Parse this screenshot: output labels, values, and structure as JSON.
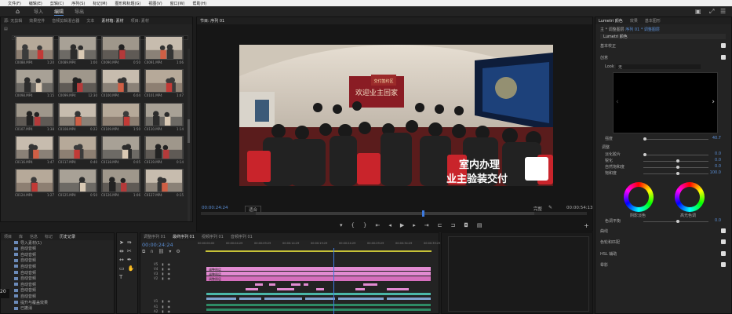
{
  "menu": [
    "文件(F)",
    "编辑(E)",
    "剪辑(C)",
    "序列(S)",
    "标记(M)",
    "图形和标题(G)",
    "视图(V)",
    "窗口(W)",
    "帮助(H)"
  ],
  "workspace_tabs": [
    "导入",
    "编辑",
    "导出"
  ],
  "source_tabs": [
    "源: 无剪辑",
    "效果控件",
    "音频剪辑混合器",
    "文本",
    "素材箱: 素材",
    "项目: 素材"
  ],
  "program_tab": "节目: 序列 01",
  "clips": [
    {
      "name": "C0088.MP4",
      "dur": "1:20"
    },
    {
      "name": "C0089.MP4",
      "dur": "1:00"
    },
    {
      "name": "C0090.MP4",
      "dur": "0:50"
    },
    {
      "name": "C0091.MP4",
      "dur": "1:06"
    },
    {
      "name": "C0098.MP4",
      "dur": "1:15"
    },
    {
      "name": "C0099.MP4",
      "dur": "12:30"
    },
    {
      "name": "C0100.MP4",
      "dur": "6:04"
    },
    {
      "name": "C0101.MP4",
      "dur": "1:47"
    },
    {
      "name": "C0107.MP4",
      "dur": "1:38"
    },
    {
      "name": "C0108.MP4",
      "dur": "0:22"
    },
    {
      "name": "C0109.MP4",
      "dur": "1:50"
    },
    {
      "name": "C0110.MP4",
      "dur": "1:14"
    },
    {
      "name": "C0116.MP4",
      "dur": "1:47"
    },
    {
      "name": "C0117.MP4",
      "dur": "0:40"
    },
    {
      "name": "C0118.MP4",
      "dur": "0:05"
    },
    {
      "name": "C0119.MP4",
      "dur": "0:14"
    },
    {
      "name": "C0124.MP4",
      "dur": "1:27"
    },
    {
      "name": "C0125.MP4",
      "dur": "0:50"
    },
    {
      "name": "C0126.MP4",
      "dur": "1:06"
    },
    {
      "name": "C0127.MP4",
      "dur": "0:15"
    }
  ],
  "program": {
    "timecode_left": "00:00:24:24",
    "fit": "适合",
    "quality": "完整",
    "timecode_right": "00:00:54:13",
    "caption_line1": "室内办理",
    "caption_line2": "业主验装交付",
    "banner_text": "欢迎业主回家",
    "sign_text": "交付签约区"
  },
  "lumetri": {
    "header_tabs": [
      "Lumetri 颜色",
      "效果",
      "基本图形"
    ],
    "source": "主 * 调整图层",
    "seq": "序列 01 * 调整图层",
    "effect": "Lumetri 颜色",
    "sections": [
      "基本校正",
      "创意",
      "曲线",
      "色轮和匹配",
      "HSL 辅助",
      "晕影"
    ],
    "look_label": "Look",
    "look_value": "无",
    "intensity_label": "强度",
    "intensity_value": "40.7",
    "adjust_label": "调整",
    "sliders": [
      {
        "label": "淡化胶片",
        "value": "0.0",
        "pos": 0.0
      },
      {
        "label": "锐化",
        "value": "0.0",
        "pos": 0.5
      },
      {
        "label": "自然饱和度",
        "value": "0.0",
        "pos": 0.5
      },
      {
        "label": "饱和度",
        "value": "100.0",
        "pos": 0.5
      }
    ],
    "wheel1": "阴影淡色",
    "wheel2": "高光色调",
    "balance_label": "色调平衡",
    "balance_value": "0.0"
  },
  "project": {
    "tabs": [
      "项目",
      "库",
      "信息",
      "标记",
      "历史记录"
    ],
    "items": [
      "导入素材(1)",
      "自动音频",
      "自动音频",
      "自动音频",
      "自动音频",
      "自动音频",
      "自动音频",
      "自动音频",
      "自动音频",
      "自动音频",
      "提升与覆盖效果",
      "已撤消"
    ]
  },
  "timeline": {
    "tabs": [
      "调整序列 01",
      "最终序列 01",
      "视频序列 01",
      "音频序列 01"
    ],
    "timecode": "00:00:24:24",
    "ruler": [
      "00:00:00:00",
      "00:00:04:29",
      "00:00:09:29",
      "00:00:14:29",
      "00:00:19:29",
      "00:00:24:29",
      "00:00:29:29",
      "00:00:34:29",
      "00:00:39:29"
    ],
    "tracks": [
      "V5",
      "V4",
      "V3",
      "V2",
      "V1",
      "A1",
      "A2"
    ],
    "adjust_clips": [
      "调整图层",
      "调整图层",
      "调整图层"
    ]
  },
  "colors": {
    "accent": "#5b8fd6",
    "playhead": "#3d7ae0",
    "pink": "#e28bd2",
    "teal": "#4ab7a8"
  }
}
